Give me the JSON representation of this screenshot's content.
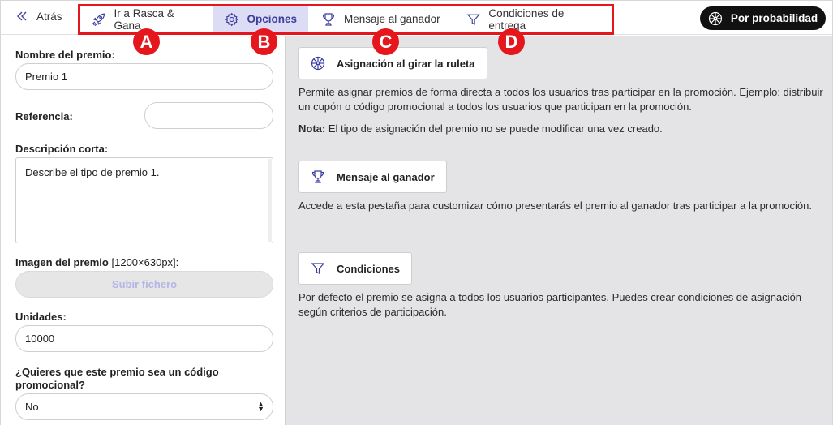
{
  "topbar": {
    "back_label": "Atrás",
    "tabs": [
      {
        "label": "Ir a Rasca & Gana",
        "icon": "rocket-icon",
        "active": false
      },
      {
        "label": "Opciones",
        "icon": "gear-icon",
        "active": true
      },
      {
        "label": "Mensaje al ganador",
        "icon": "trophy-icon",
        "active": false
      },
      {
        "label": "Condiciones de entrega",
        "icon": "filter-icon",
        "active": false
      }
    ],
    "markers": [
      "A",
      "B",
      "C",
      "D"
    ],
    "probability_button": "Por probabilidad"
  },
  "form": {
    "name_label": "Nombre del premio:",
    "name_value": "Premio 1",
    "reference_label": "Referencia:",
    "reference_value": "",
    "description_label": "Descripción corta:",
    "description_value": "Describe el  tipo de premio 1.",
    "image_label": "Imagen del premio",
    "image_size": "[1200×630px]:",
    "upload_label": "Subir fichero",
    "units_label": "Unidades:",
    "units_value": "10000",
    "promo_code_label": "¿Quieres que este premio sea un código promocional?",
    "promo_code_value": "No"
  },
  "info": {
    "assignment_button": "Asignación al girar la ruleta",
    "assignment_text": "Permite asignar premios de forma directa a todos los usuarios tras participar en la promoción. Ejemplo: distribuir un cupón o código promocional a todos los usuarios que participan en la promoción.",
    "note_label": "Nota:",
    "note_text": "El tipo de asignación del premio no se puede modificar una vez creado.",
    "winner_button": "Mensaje al ganador",
    "winner_text": "Accede a esta pestaña para customizar cómo presentarás el premio al ganador tras participar a la promoción.",
    "conditions_button": "Condiciones",
    "conditions_text": "Por defecto el premio se asigna a todos los usuarios participantes. Puedes crear condiciones de asignación según criterios de participación."
  },
  "colors": {
    "accent": "#3d3d9e",
    "active_tab_bg": "#dcdcf5",
    "highlight_red": "#e5161c",
    "panel_bg": "#e4e4e6"
  }
}
